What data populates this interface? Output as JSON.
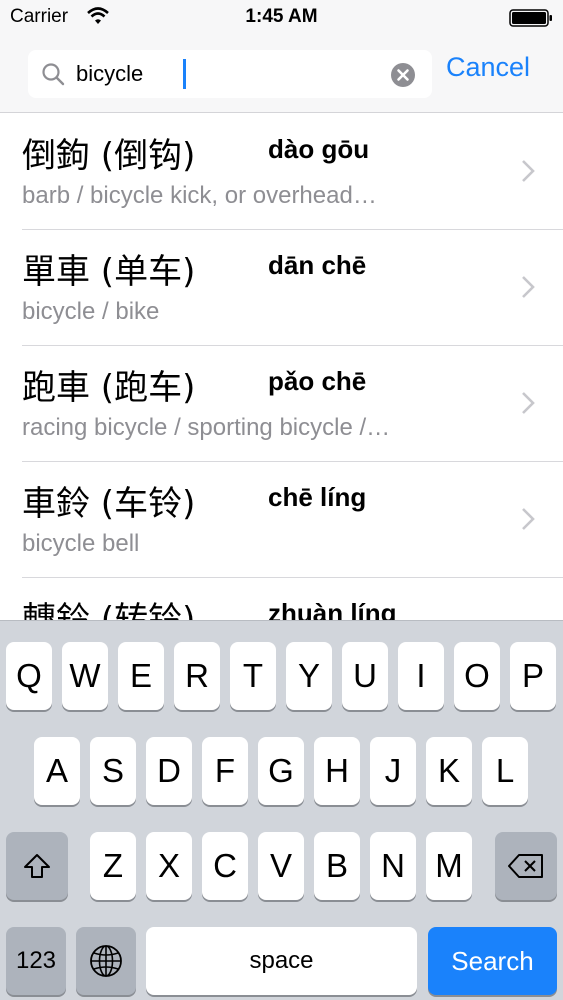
{
  "status_bar": {
    "carrier": "Carrier",
    "time": "1:45 AM"
  },
  "search": {
    "query": "bicycle",
    "cancel_label": "Cancel"
  },
  "results": [
    {
      "chars": "倒鉤 (倒钩)",
      "pinyin": "dào gōu",
      "meaning": "barb / bicycle kick, or overhead…"
    },
    {
      "chars": "單車 (单车)",
      "pinyin": "dān chē",
      "meaning": "bicycle / bike"
    },
    {
      "chars": "跑車 (跑车)",
      "pinyin": "pǎo chē",
      "meaning": "racing bicycle / sporting bicycle /…"
    },
    {
      "chars": "車鈴 (车铃)",
      "pinyin": "chē líng",
      "meaning": "bicycle bell"
    },
    {
      "chars": "轉鈴 (转铃)",
      "pinyin": "zhuàn líng",
      "meaning": ""
    }
  ],
  "keyboard": {
    "row1": [
      "Q",
      "W",
      "E",
      "R",
      "T",
      "Y",
      "U",
      "I",
      "O",
      "P"
    ],
    "row2": [
      "A",
      "S",
      "D",
      "F",
      "G",
      "H",
      "J",
      "K",
      "L"
    ],
    "row3": [
      "Z",
      "X",
      "C",
      "V",
      "B",
      "N",
      "M"
    ],
    "numbers_label": "123",
    "space_label": "space",
    "search_label": "Search"
  },
  "colors": {
    "accent": "#1a82fb",
    "secondary_text": "#8e8e93",
    "keyboard_bg": "#d1d5db"
  }
}
